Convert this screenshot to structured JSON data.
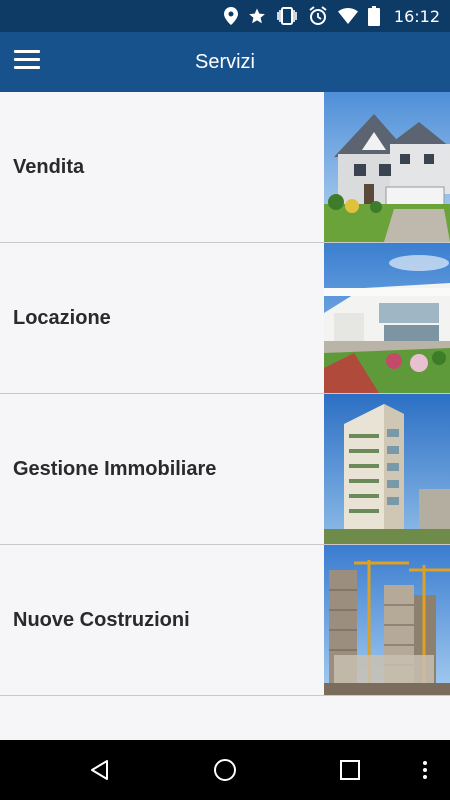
{
  "status_bar": {
    "time": "16:12",
    "icons": [
      "location-icon",
      "star-icon",
      "vibrate-icon",
      "alarm-icon",
      "wifi-icon",
      "battery-icon"
    ]
  },
  "app_bar": {
    "title": "Servizi",
    "menu_icon": "hamburger-menu-icon"
  },
  "services": [
    {
      "label": "Vendita",
      "image": "suburban-house"
    },
    {
      "label": "Locazione",
      "image": "modern-villa"
    },
    {
      "label": "Gestione Immobiliare",
      "image": "apartment-tower"
    },
    {
      "label": "Nuove Costruzioni",
      "image": "construction-site"
    }
  ],
  "nav_bar": {
    "icons": [
      "back-icon",
      "home-icon",
      "recents-icon",
      "overflow-menu-icon"
    ]
  },
  "colors": {
    "status_bar": "#0e3a66",
    "app_bar": "#17528c",
    "list_background": "#f6f5f7",
    "divider": "#c9c9cc",
    "label_text": "#2a2a2a"
  }
}
